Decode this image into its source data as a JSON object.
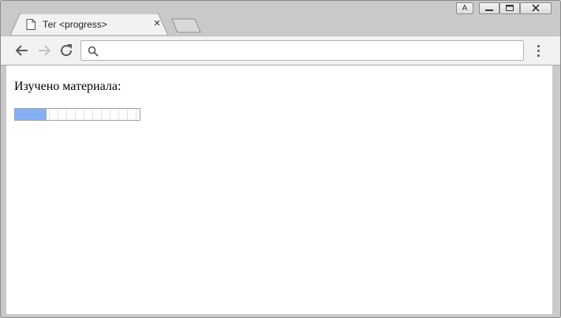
{
  "tab": {
    "title": "Тег <progress>",
    "close_label": "×",
    "icon": "document-icon"
  },
  "window_controls": {
    "profile_label": "A"
  },
  "toolbar": {
    "address_value": "",
    "address_placeholder": ""
  },
  "page": {
    "label": "Изучено материала:",
    "progress_fraction": 0.25,
    "progress_color": "#86b0f5"
  }
}
